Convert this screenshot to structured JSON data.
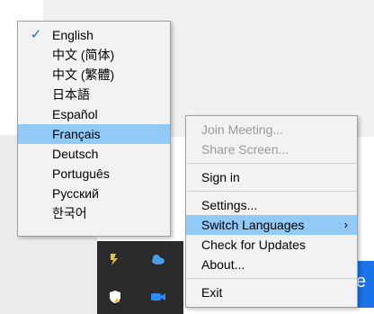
{
  "language_menu": {
    "items": [
      {
        "label": "English",
        "checked": true
      },
      {
        "label": "中文 (简体)"
      },
      {
        "label": "中文 (繁體)"
      },
      {
        "label": "日本語"
      },
      {
        "label": "Español"
      },
      {
        "label": "Français",
        "highlighted": true
      },
      {
        "label": "Deutsch"
      },
      {
        "label": "Português"
      },
      {
        "label": "Русский"
      },
      {
        "label": "한국어"
      }
    ],
    "check_glyph": "✓"
  },
  "context_menu": {
    "join_meeting": "Join Meeting...",
    "share_screen": "Share Screen...",
    "sign_in": "Sign in",
    "settings": "Settings...",
    "switch_languages": "Switch Languages",
    "submenu_arrow": "›",
    "check_updates": "Check for Updates",
    "about": "About...",
    "exit": "Exit"
  },
  "background": {
    "blue_button_letter": "e"
  },
  "colors": {
    "highlight": "#91c9f7",
    "menu_bg": "#f2f2f2",
    "tray_bg": "#2b2b2b",
    "accent_blue": "#1a73e8"
  }
}
